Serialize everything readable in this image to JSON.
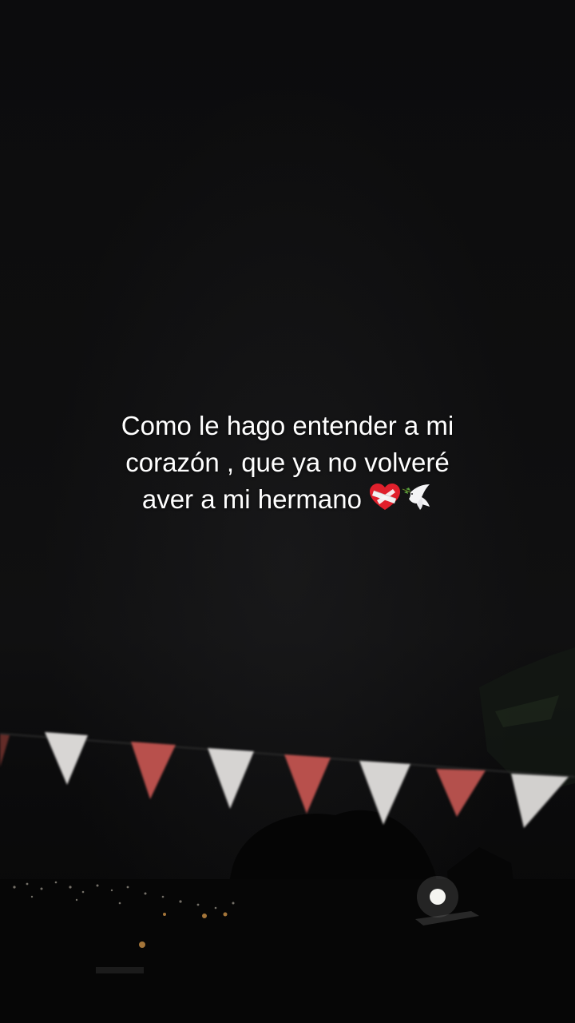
{
  "caption": {
    "line1": "Como le hago entender a mi",
    "line2": "corazón , que ya no volveré",
    "line3": "aver a mi hermano"
  },
  "icons": {
    "heart": "mending-heart-icon",
    "dove": "dove-icon"
  },
  "colors": {
    "background": "#0b0b0c",
    "text": "#ffffff",
    "flag_white": "#d8d6d4",
    "flag_red": "#b8504c"
  }
}
